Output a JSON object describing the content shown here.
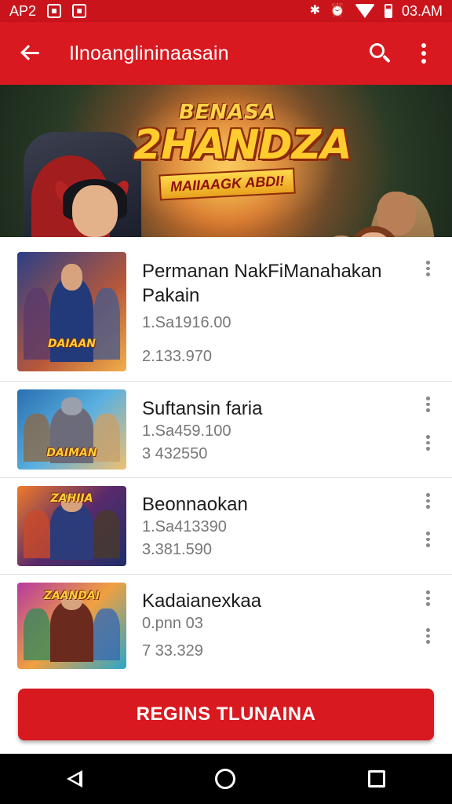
{
  "status_bar": {
    "carrier": "AP2",
    "time": "03.AM",
    "icons": [
      "square-icon",
      "image-icon",
      "bluetooth-icon",
      "alarm-icon",
      "wifi-icon",
      "battery-icon"
    ]
  },
  "app_bar": {
    "title": "Ilnoanglininaasain"
  },
  "banner": {
    "logo_top": "BENASA",
    "logo_main": "2HANDZA",
    "logo_tag": "MAIIAAGK ABDI!"
  },
  "list": {
    "items": [
      {
        "title": "Permanan NakFiManahakan Pakain",
        "line1": "1.Sa1916.00",
        "line2": "2.133.970",
        "thumb_logo": "DAIAAN",
        "thumb_colors": [
          "#3a5fa0",
          "#f0a23a"
        ]
      },
      {
        "title": "Suftansin faria",
        "line1": "1.Sa459.100",
        "line2": "3 432550",
        "thumb_logo": "DAIMAN",
        "thumb_colors": [
          "#2f7fb8",
          "#c9a06a"
        ]
      },
      {
        "title": "Beonnaokan",
        "line1": "1.Sa413390",
        "line2": "3.381.590",
        "thumb_logo": "ZAHIIA",
        "thumb_colors": [
          "#f07a2a",
          "#2c3b7a"
        ]
      },
      {
        "title": "Kadaianexkaa",
        "line1": "0.pnn 03",
        "line2": "7 33.329",
        "thumb_logo": "ZAANDAI",
        "thumb_colors": [
          "#b63aa0",
          "#2aa7c9"
        ]
      }
    ]
  },
  "cta": {
    "label": "REGINS TLUNAINA"
  },
  "colors": {
    "primary": "#d8191f",
    "status": "#c9141c",
    "text_secondary": "#777777"
  }
}
